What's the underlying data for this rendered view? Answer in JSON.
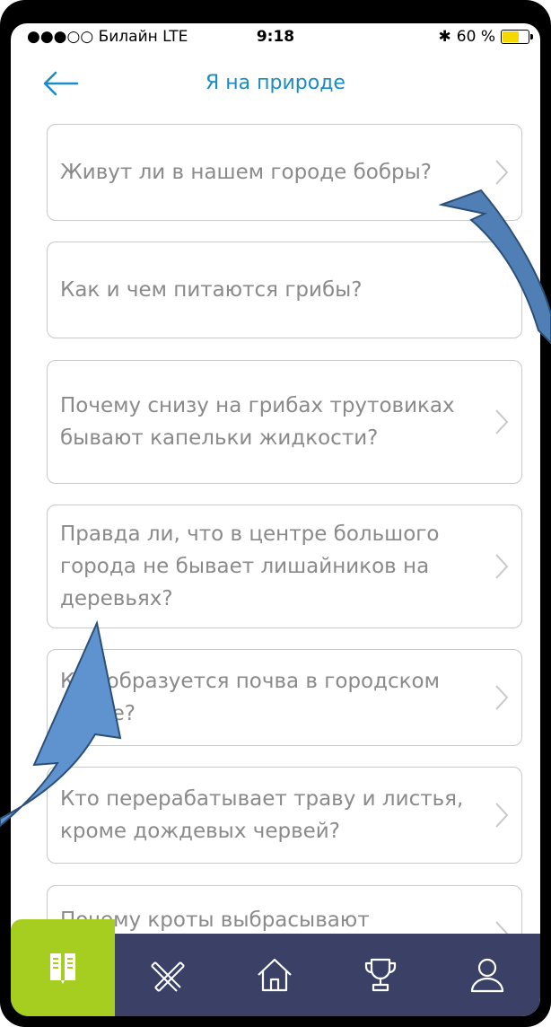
{
  "status_bar": {
    "carrier": "●●●○○ Билайн  LTE",
    "time": "9:18",
    "battery": "60 %",
    "battery_level": 0.6
  },
  "header": {
    "title": "Я на природе"
  },
  "questions": [
    {
      "text": "Живут ли в нашем городе бобры?"
    },
    {
      "text": "Как и чем питаются грибы?"
    },
    {
      "text": "Почему снизу на грибах трутовиках бывают капельки жидкости?"
    },
    {
      "text": "Правда ли, что в центре большого города не бывает лишайников на деревьях?"
    },
    {
      "text": "Как образуется почва в городском парке?"
    },
    {
      "text": "Кто перерабатывает траву и листья, кроме дождевых червей?"
    },
    {
      "text": "Почему кроты выбрасывают"
    }
  ],
  "tabs": [
    {
      "icon": "book-icon",
      "active": true
    },
    {
      "icon": "pencil-ruler-icon",
      "active": false
    },
    {
      "icon": "home-icon",
      "active": false
    },
    {
      "icon": "trophy-icon",
      "active": false
    },
    {
      "icon": "user-icon",
      "active": false
    }
  ],
  "colors": {
    "accent": "#1a8bc4",
    "tabbar": "#3b4166",
    "tab_active": "#a6ce21",
    "annotation_arrow": "#4f7fb5"
  }
}
